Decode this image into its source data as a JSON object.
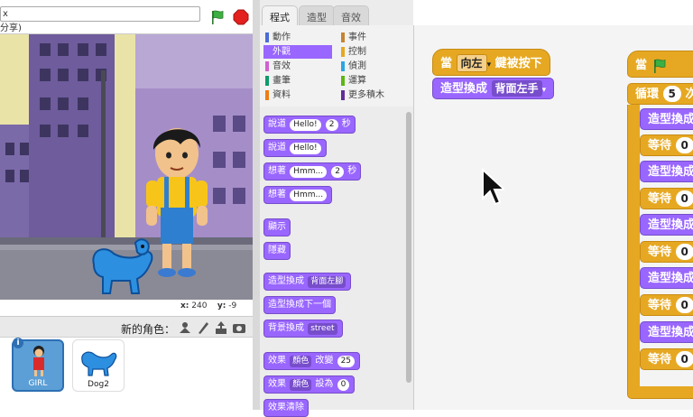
{
  "stage": {
    "title_value": "x",
    "share_text": "分享)",
    "coords": {
      "x_label": "x:",
      "x_value": "240",
      "y_label": "y:",
      "y_value": "-9"
    }
  },
  "sprites": {
    "new_sprite_label": "新的角色：",
    "items": [
      {
        "name": "GIRL",
        "selected": true
      },
      {
        "name": "Dog2",
        "selected": false
      }
    ]
  },
  "palette": {
    "tabs": [
      "程式",
      "造型",
      "音效"
    ],
    "active_tab": 0,
    "categories": [
      {
        "label": "動作",
        "color": "#4a6cd4"
      },
      {
        "label": "事件",
        "color": "#c88330"
      },
      {
        "label": "外觀",
        "color": "#9966ff"
      },
      {
        "label": "控制",
        "color": "#e6a822"
      },
      {
        "label": "音效",
        "color": "#cf63cf"
      },
      {
        "label": "偵測",
        "color": "#2ca5e2"
      },
      {
        "label": "畫筆",
        "color": "#0e9a6c"
      },
      {
        "label": "運算",
        "color": "#5cb712"
      },
      {
        "label": "資料",
        "color": "#ee7d16"
      },
      {
        "label": "更多積木",
        "color": "#632d99"
      }
    ],
    "selected_category": 2,
    "blocks": {
      "say_secs": {
        "pre": "說道",
        "slot": "Hello!",
        "num": "2",
        "post": "秒"
      },
      "say": {
        "pre": "說道",
        "slot": "Hello!"
      },
      "think_secs": {
        "pre": "想著",
        "slot": "Hmm...",
        "num": "2",
        "post": "秒"
      },
      "think": {
        "pre": "想著",
        "slot": "Hmm..."
      },
      "show": "顯示",
      "hide": "隱藏",
      "switch_costume": {
        "pre": "造型換成",
        "dd": "背面左腳"
      },
      "next_costume": "造型換成下一個",
      "switch_backdrop": {
        "pre": "背景換成",
        "dd": "street"
      },
      "change_effect": {
        "pre": "效果",
        "dd": "顏色",
        "mid": "改變",
        "num": "25"
      },
      "set_effect": {
        "pre": "效果",
        "dd": "顏色",
        "mid": "設為",
        "num": "0"
      },
      "clear_effects": "效果清除"
    }
  },
  "scripts": {
    "script1": {
      "hat": {
        "pre": "當",
        "key": "向左",
        "post": "鍵被按下"
      },
      "costume": {
        "pre": "造型換成",
        "dd": "背面左手"
      }
    },
    "script2": {
      "hat": {
        "pre": "當"
      },
      "repeat": {
        "pre": "循環",
        "num": "5",
        "post": "次"
      },
      "items": [
        {
          "type": "costume",
          "label": "造型換成"
        },
        {
          "type": "wait",
          "label": "等待",
          "num": "0"
        },
        {
          "type": "costume",
          "label": "造型換成"
        },
        {
          "type": "wait",
          "label": "等待",
          "num": "0"
        },
        {
          "type": "costume",
          "label": "造型換成"
        },
        {
          "type": "wait",
          "label": "等待",
          "num": "0"
        },
        {
          "type": "costume",
          "label": "造型換成"
        },
        {
          "type": "wait",
          "label": "等待",
          "num": "0"
        },
        {
          "type": "costume",
          "label": "造型換成"
        },
        {
          "type": "wait",
          "label": "等待",
          "num": "0"
        }
      ]
    }
  }
}
